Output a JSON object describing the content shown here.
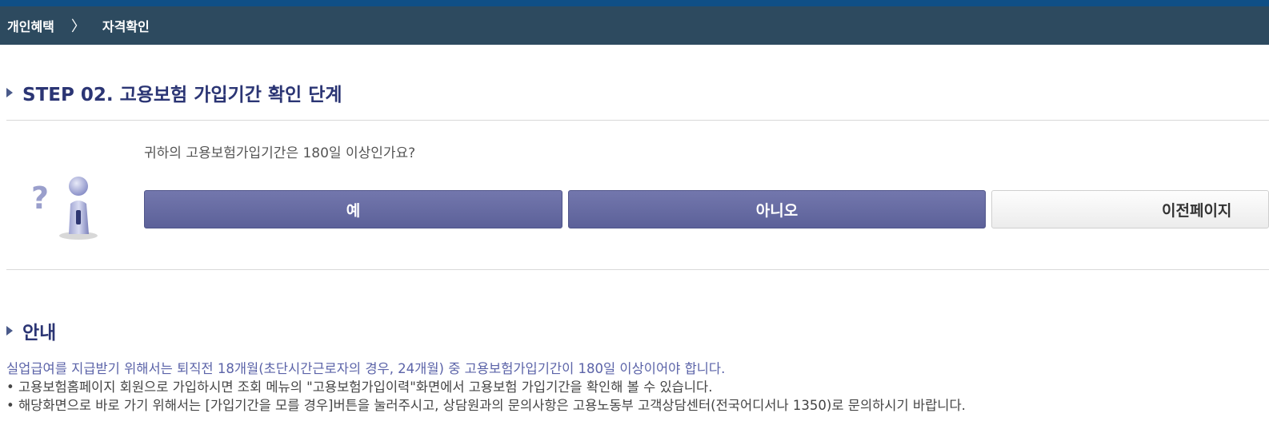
{
  "breadcrumb": {
    "items": [
      "개인혜택",
      "자격확인"
    ],
    "separator": "〉"
  },
  "step": {
    "title": "STEP 02. 고용보험 가입기간 확인 단계"
  },
  "question": {
    "text": "귀하의 고용보험가입기간은 180일 이상인가요?",
    "icon": "question-person-icon"
  },
  "buttons": {
    "yes": "예",
    "no": "아니오",
    "prev": "이전페이지"
  },
  "guide": {
    "title": "안내",
    "lead": "실업급여를 지급받기 위해서는 퇴직전 18개월(초단시간근로자의 경우, 24개월) 중 고용보험가입기간이 180일 이상이어야 합니다.",
    "bullets": [
      "• 고용보험홈페이지 회원으로 가입하시면 조회 메뉴의 \"고용보험가입이력\"화면에서 고용보험 가입기간을 확인해 볼 수 있습니다.",
      "• 해당화면으로 바로 가기 위해서는 [가입기간을 모를 경우]버튼을 눌러주시고, 상담원과의 문의사항은 고용노동부 고객상담센터(전국어디서나 1350)로 문의하시기 바랍니다."
    ]
  },
  "colors": {
    "top_strip": "#0f4f86",
    "breadcrumb_bg": "#2d4a5f",
    "title": "#2b3574",
    "primary_button": "#656aa3",
    "lead_text": "#5b63a8"
  }
}
